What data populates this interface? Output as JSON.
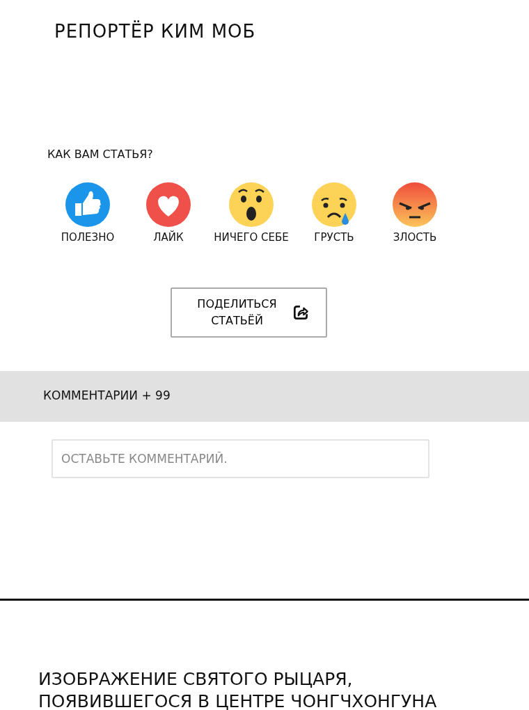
{
  "author": "РЕПОРТЁР КИМ МОБ",
  "question": "КАК ВАМ СТАТЬЯ?",
  "reactions": [
    {
      "kind": "like",
      "label": "ПОЛЕЗНО"
    },
    {
      "kind": "love",
      "label": "ЛАЙК"
    },
    {
      "kind": "wow",
      "label": "НИЧЕГО СЕБЕ"
    },
    {
      "kind": "sad",
      "label": "ГРУСТЬ"
    },
    {
      "kind": "angry",
      "label": "ЗЛОСТЬ"
    }
  ],
  "share_button": {
    "label": "ПОДЕЛИТЬСЯ СТАТЬЁЙ"
  },
  "comments": {
    "title": "КОММЕНТАРИИ + 99",
    "placeholder": "ОСТАВЬТЕ КОММЕНТАРИЙ."
  },
  "caption": "ИЗОБРАЖЕНИЕ СВЯТОГО РЫЦАРЯ, ПОЯВИВШЕГОСЯ В ЦЕНТРЕ ЧОНГЧХОНГУНА"
}
